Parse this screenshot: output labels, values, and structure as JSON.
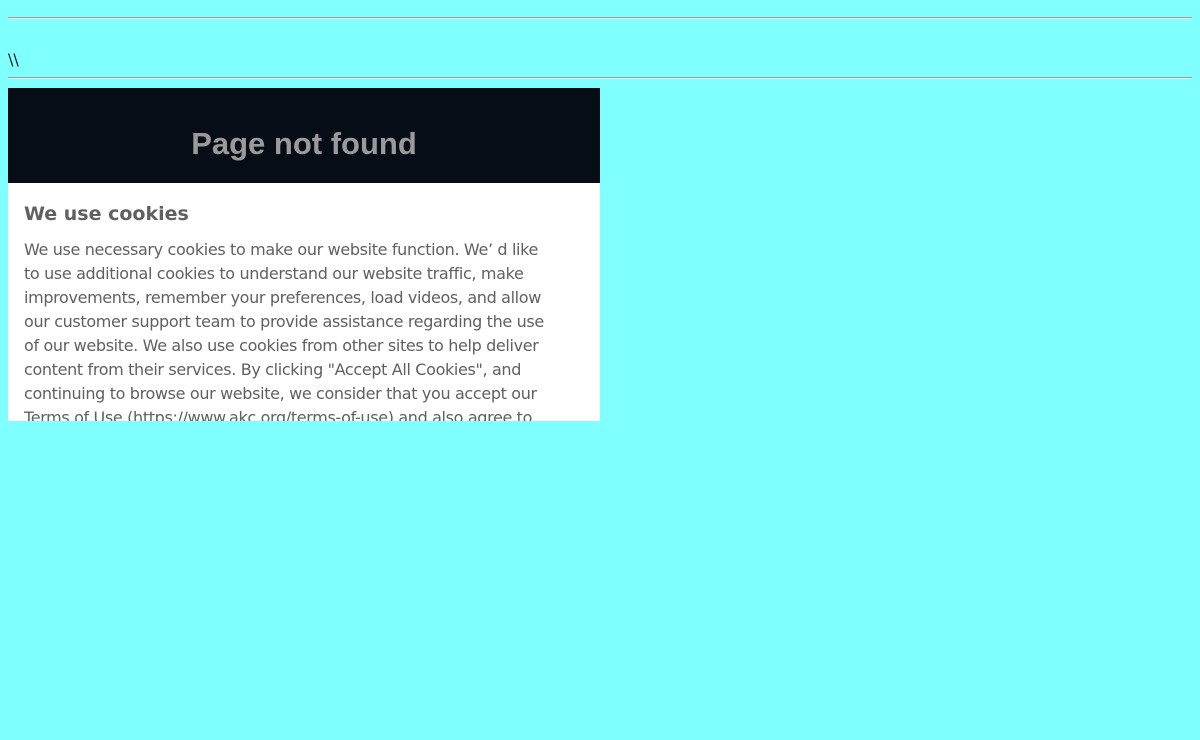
{
  "top_text": "\\\\",
  "banner": {
    "title": "Page not found"
  },
  "cookie_notice": {
    "title": "We use cookies",
    "lines": [
      "We use necessary cookies to make our website function. We’ d like",
      "to use additional cookies to understand our website traffic, make",
      "improvements, remember your preferences, load videos, and allow",
      "our customer support team to provide assistance regarding the use",
      "of our website. We also use cookies from other sites to help deliver",
      "content from their services. By clicking \"Accept All Cookies\", and",
      "continuing to browse our website, we consider that you accept our",
      "Terms of Use (https://www.akc.org/terms-of-use) and also agree to"
    ]
  },
  "colors": {
    "page_background": "#80ffff",
    "banner_background": "#070d17",
    "banner_text": "#9a9a9a",
    "panel_background": "#ffffff",
    "panel_text": "#606060"
  }
}
